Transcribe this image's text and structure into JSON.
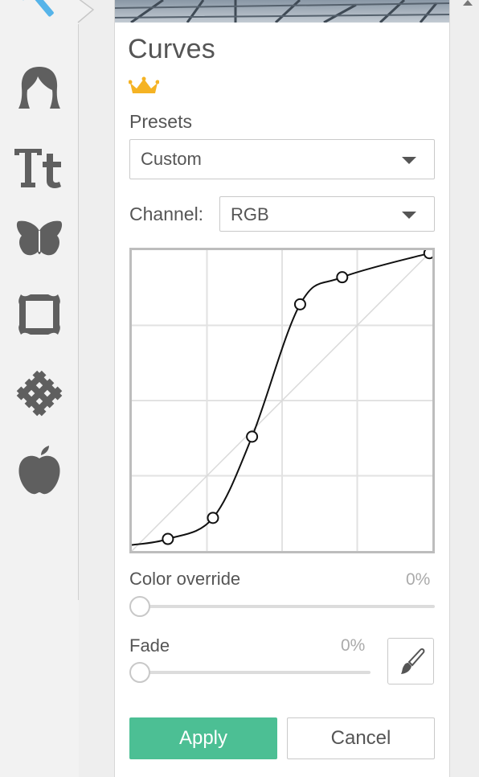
{
  "panel": {
    "title": "Curves",
    "presets_label": "Presets",
    "preset_value": "Custom",
    "channel_label": "Channel:",
    "channel_value": "RGB",
    "color_override_label": "Color override",
    "color_override_value": "0%",
    "fade_label": "Fade",
    "fade_value": "0%",
    "apply_label": "Apply",
    "cancel_label": "Cancel"
  },
  "tools": [
    {
      "name": "magic-wand-icon"
    },
    {
      "name": "face-icon"
    },
    {
      "name": "text-icon"
    },
    {
      "name": "butterfly-icon"
    },
    {
      "name": "frame-icon"
    },
    {
      "name": "texture-icon"
    },
    {
      "name": "apple-icon"
    }
  ],
  "curve": {
    "points": [
      [
        12,
        4
      ],
      [
        27,
        11
      ],
      [
        40,
        38
      ],
      [
        56,
        82
      ],
      [
        70,
        91
      ],
      [
        99,
        99
      ]
    ]
  },
  "colors": {
    "accent": "#4cbf94",
    "premium": "#f5b324",
    "icon": "#5f5f5f",
    "active_tool": "#56b4e9"
  }
}
